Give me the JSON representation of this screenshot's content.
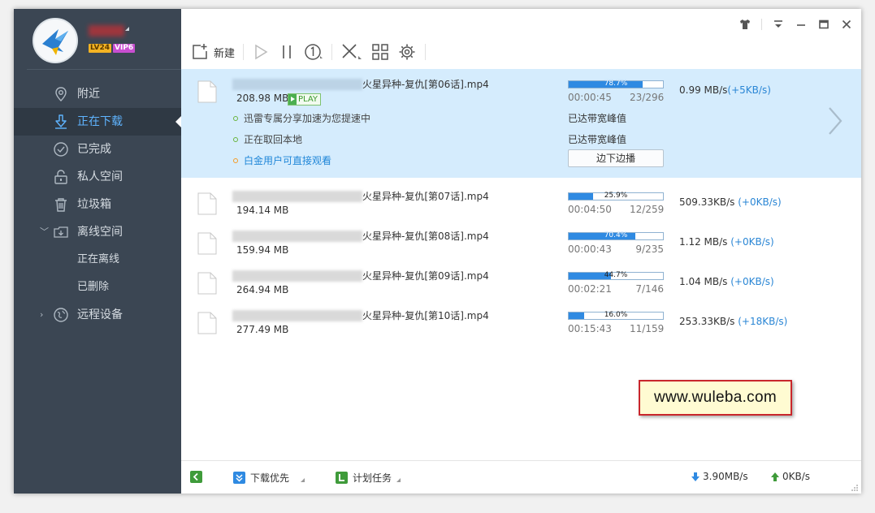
{
  "user": {
    "level_badge": "LV24",
    "vip_badge": "VIP6"
  },
  "sidebar": {
    "items": [
      {
        "label": "附近",
        "icon": "location-pin-icon"
      },
      {
        "label": "正在下载",
        "icon": "download-arrow-icon"
      },
      {
        "label": "已完成",
        "icon": "check-circle-icon"
      },
      {
        "label": "私人空间",
        "icon": "lock-icon"
      },
      {
        "label": "垃圾箱",
        "icon": "trash-icon"
      },
      {
        "label": "离线空间",
        "icon": "offline-space-icon"
      },
      {
        "label": "正在离线",
        "icon": ""
      },
      {
        "label": "已删除",
        "icon": ""
      },
      {
        "label": "远程设备",
        "icon": "remote-device-icon"
      }
    ],
    "active_index": 1
  },
  "toolbar": {
    "new_label": "新建"
  },
  "downloads": [
    {
      "name": "火星异种-复仇[第06话].mp4",
      "size": "208.98 MB",
      "play_label": "PLAY",
      "progress_pct": 78.7,
      "progress_label": "78.7%",
      "time": "00:00:45",
      "pieces": "23/296",
      "speed": "0.99   MB/s",
      "speed_inc": "(+5KB/s)",
      "status_lines": [
        "迅雷专属分享加速为您提速中",
        "正在取回本地",
        "白金用户可直接观看"
      ],
      "bandwidth_notes": [
        "已达带宽峰值",
        "已达带宽峰值"
      ],
      "stream_button": "边下边播"
    },
    {
      "name": "火星异种-复仇[第07话].mp4",
      "size": "194.14 MB",
      "progress_pct": 25.9,
      "progress_label": "25.9%",
      "time": "00:04:50",
      "pieces": "12/259",
      "speed": "509.33KB/s",
      "speed_inc": "(+0KB/s)"
    },
    {
      "name": "火星异种-复仇[第08话].mp4",
      "size": "159.94 MB",
      "progress_pct": 70.4,
      "progress_label": "70.4%",
      "time": "00:00:43",
      "pieces": "9/235",
      "speed": "1.12   MB/s",
      "speed_inc": "(+0KB/s)"
    },
    {
      "name": "火星异种-复仇[第09话].mp4",
      "size": "264.94 MB",
      "progress_pct": 44.7,
      "progress_label": "44.7%",
      "time": "00:02:21",
      "pieces": "7/146",
      "speed": "1.04   MB/s",
      "speed_inc": "(+0KB/s)"
    },
    {
      "name": "火星异种-复仇[第10话].mp4",
      "size": "277.49 MB",
      "progress_pct": 16.0,
      "progress_label": "16.0%",
      "time": "00:15:43",
      "pieces": "11/159",
      "speed": "253.33KB/s",
      "speed_inc": "(+18KB/s)"
    }
  ],
  "watermark": "www.wuleba.com",
  "statusbar": {
    "priority_label": "下载优先",
    "schedule_label": "计划任务",
    "download_speed": "3.90MB/s",
    "upload_speed": "0KB/s"
  },
  "colors": {
    "sidebar_bg": "#3b4653",
    "accent_blue": "#2f8ae2",
    "selected_row": "#d5ecfd",
    "green": "#4caf50"
  }
}
